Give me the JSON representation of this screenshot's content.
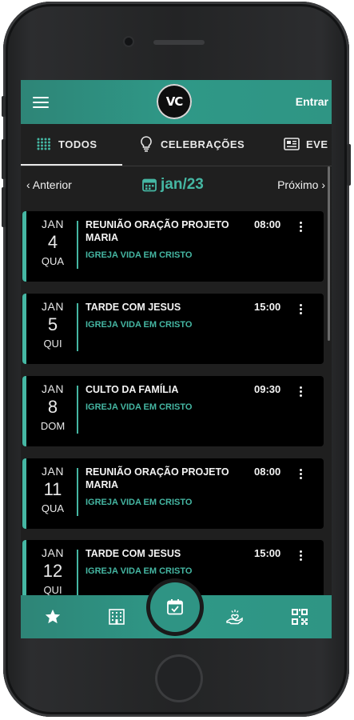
{
  "header": {
    "login_label": "Entrar",
    "logo_text": "VC"
  },
  "tabs": [
    {
      "label": "TODOS",
      "icon": "grid-dots-icon",
      "active": true
    },
    {
      "label": "CELEBRAÇÕES",
      "icon": "lightbulb-icon",
      "active": false
    },
    {
      "label": "EVE",
      "icon": "newspaper-icon",
      "active": false
    }
  ],
  "month_nav": {
    "prev_label": "Anterior",
    "current": "jan/23",
    "next_label": "Próximo"
  },
  "events": [
    {
      "month": "JAN",
      "day": "4",
      "weekday": "QUA",
      "title": "REUNIÃO ORAÇÃO PROJETO MARIA",
      "church": "IGREJA VIDA EM CRISTO",
      "time": "08:00"
    },
    {
      "month": "JAN",
      "day": "5",
      "weekday": "QUI",
      "title": "TARDE COM JESUS",
      "church": "IGREJA VIDA EM CRISTO",
      "time": "15:00"
    },
    {
      "month": "JAN",
      "day": "8",
      "weekday": "DOM",
      "title": "CULTO DA FAMÍLIA",
      "church": "IGREJA VIDA EM CRISTO",
      "time": "09:30"
    },
    {
      "month": "JAN",
      "day": "11",
      "weekday": "QUA",
      "title": "REUNIÃO ORAÇÃO PROJETO MARIA",
      "church": "IGREJA VIDA EM CRISTO",
      "time": "08:00"
    },
    {
      "month": "JAN",
      "day": "12",
      "weekday": "QUI",
      "title": "TARDE COM JESUS",
      "church": "IGREJA VIDA EM CRISTO",
      "time": "15:00"
    }
  ],
  "bottom_nav": [
    {
      "icon": "star-icon"
    },
    {
      "icon": "building-icon"
    },
    {
      "icon": "calendar-icon",
      "active": true
    },
    {
      "icon": "hand-heart-icon"
    },
    {
      "icon": "qr-code-icon"
    }
  ],
  "colors": {
    "accent": "#45b7a3",
    "bar": "#2f9585",
    "background": "#1f1f1f",
    "card": "#000000"
  }
}
